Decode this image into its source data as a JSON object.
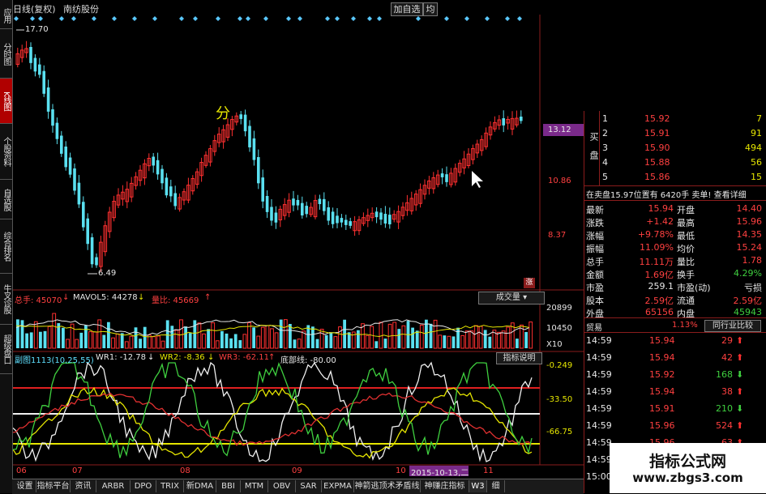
{
  "left_tabs": [
    "应用",
    "分时图",
    "K线图",
    "个股资料",
    "自选股",
    "综合排名",
    "牛叉诊股",
    "超级盘口"
  ],
  "topbar": {
    "mode": "日线(复权)",
    "stock": "南纺股份",
    "add_btn": "加自选",
    "extra": "均"
  },
  "main_chart": {
    "label_high": "17.70",
    "label_low": "6.49",
    "mid_text": "分",
    "axis": [
      "13.12",
      "10.86",
      "8.37"
    ],
    "badge": "涨"
  },
  "volume": {
    "hand": "总手: 45070",
    "mavol": "MAVOL5: 44278",
    "ratio": "量比: 45669",
    "btn": "成交量",
    "axis": [
      "20899",
      "10450",
      "X10"
    ]
  },
  "indicator": {
    "title": "副图1113(10,25,55)",
    "wr1": "WR1: -12.78",
    "wr2": "WR2: -8.36",
    "wr3": "WR3: -62.11",
    "bottom": "底部线: -80.00",
    "btn": "指标说明",
    "axis": [
      "-0.249",
      "-33.50",
      "-66.75"
    ]
  },
  "dates": [
    "06",
    "07",
    "08",
    "09",
    "10",
    "11"
  ],
  "date_hl": "2015-10-13,二",
  "order_book": {
    "side_buy": "买盘",
    "rows": [
      {
        "n": "1",
        "p": "15.92",
        "v": "7"
      },
      {
        "n": "2",
        "p": "15.91",
        "v": "91"
      },
      {
        "n": "3",
        "p": "15.90",
        "v": "494"
      },
      {
        "n": "4",
        "p": "15.88",
        "v": "56"
      },
      {
        "n": "5",
        "p": "15.86",
        "v": "15"
      }
    ],
    "info": "在卖盘15.97位置有 6420手 卖单! 查看详细"
  },
  "quote": [
    {
      "a": "最新",
      "av": "15.94",
      "b": "开盘",
      "bv": "14.40"
    },
    {
      "a": "涨跌",
      "av": "+1.42",
      "b": "最高",
      "bv": "15.96"
    },
    {
      "a": "涨幅",
      "av": "+9.78%",
      "b": "最低",
      "bv": "14.35"
    },
    {
      "a": "振幅",
      "av": "11.09%",
      "b": "均价",
      "bv": "15.24"
    },
    {
      "a": "总手",
      "av": "11.11万",
      "b": "量比",
      "bv": "1.78"
    },
    {
      "a": "金额",
      "av": "1.69亿",
      "b": "换手",
      "bv": "4.29%"
    },
    {
      "a": "市盈",
      "av": "259.1",
      "b": "市盈(动)",
      "bv": "亏损"
    },
    {
      "a": "股本",
      "av": "2.59亿",
      "b": "流通",
      "bv": "2.59亿"
    },
    {
      "a": "外盘",
      "av": "65156",
      "b": "内盘",
      "bv": "45943"
    }
  ],
  "trade_bar": {
    "name": "贸易",
    "pct": "1.13%",
    "btn": "同行业比较"
  },
  "ticks": [
    {
      "t": "14:59",
      "p": "15.94",
      "v": "29",
      "d": "up"
    },
    {
      "t": "14:59",
      "p": "15.94",
      "v": "42",
      "d": "up"
    },
    {
      "t": "14:59",
      "p": "15.92",
      "v": "168",
      "d": "down"
    },
    {
      "t": "14:59",
      "p": "15.94",
      "v": "38",
      "d": "up"
    },
    {
      "t": "14:59",
      "p": "15.91",
      "v": "210",
      "d": "down"
    },
    {
      "t": "14:59",
      "p": "15.96",
      "v": "524",
      "d": "up"
    },
    {
      "t": "14:59",
      "p": "15.96",
      "v": "63",
      "d": "up"
    },
    {
      "t": "14:59",
      "p": "15.96",
      "v": "148",
      "d": "down"
    },
    {
      "t": "15:00",
      "p": "",
      "v": "",
      "d": ""
    }
  ],
  "bottom_tabs": [
    "设置",
    "指标平台",
    "资讯",
    "ARBR",
    "DPO",
    "TRIX",
    "新DMA",
    "BBI",
    "MTM",
    "OBV",
    "SAR",
    "EXPMA",
    "神箭逃顶术矛盾线",
    "神赚庄指标",
    "W3",
    "细"
  ],
  "watermark": {
    "title": "指标公式网",
    "url": "www.zbgs3.com"
  },
  "colors": {
    "up": "#ff3030",
    "down": "#5ae0f0",
    "bg": "#000000",
    "border": "#8a1c1c"
  }
}
